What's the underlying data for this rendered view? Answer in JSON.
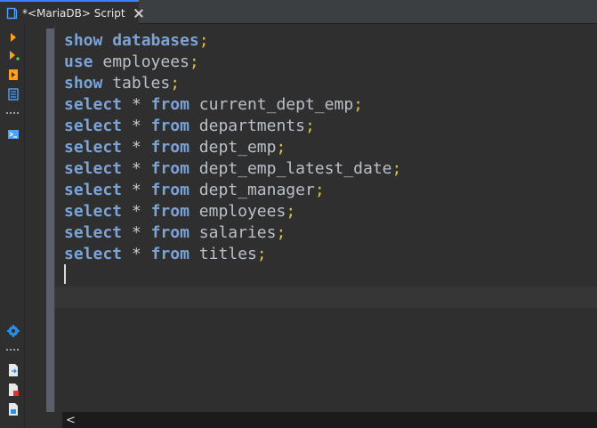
{
  "tab": {
    "title": "*<MariaDB> Script",
    "icon": "sql-script-icon"
  },
  "toolbar": {
    "items": [
      "execute-statement-icon",
      "execute-script-icon",
      "execute-new-tab-icon",
      "explain-plan-icon",
      "more-dots-icon",
      "show-output-icon",
      "settings-icon",
      "more-dots-icon",
      "export-icon",
      "import-icon",
      "save-file-icon"
    ]
  },
  "editor": {
    "lines": [
      [
        {
          "t": "kw",
          "v": "show"
        },
        {
          "t": "sp",
          "v": " "
        },
        {
          "t": "kw",
          "v": "databases"
        },
        {
          "t": "semi",
          "v": ";"
        }
      ],
      [
        {
          "t": "kw",
          "v": "use"
        },
        {
          "t": "sp",
          "v": " "
        },
        {
          "t": "id",
          "v": "employees"
        },
        {
          "t": "semi",
          "v": ";"
        }
      ],
      [
        {
          "t": "kw",
          "v": "show"
        },
        {
          "t": "sp",
          "v": " "
        },
        {
          "t": "id",
          "v": "tables"
        },
        {
          "t": "semi",
          "v": ";"
        }
      ],
      [
        {
          "t": "kw",
          "v": "select"
        },
        {
          "t": "sp",
          "v": " "
        },
        {
          "t": "op",
          "v": "*"
        },
        {
          "t": "sp",
          "v": " "
        },
        {
          "t": "kw",
          "v": "from"
        },
        {
          "t": "sp",
          "v": " "
        },
        {
          "t": "id",
          "v": "current_dept_emp"
        },
        {
          "t": "semi",
          "v": ";"
        }
      ],
      [
        {
          "t": "kw",
          "v": "select"
        },
        {
          "t": "sp",
          "v": " "
        },
        {
          "t": "op",
          "v": "*"
        },
        {
          "t": "sp",
          "v": " "
        },
        {
          "t": "kw",
          "v": "from"
        },
        {
          "t": "sp",
          "v": " "
        },
        {
          "t": "id",
          "v": "departments"
        },
        {
          "t": "semi",
          "v": ";"
        }
      ],
      [
        {
          "t": "kw",
          "v": "select"
        },
        {
          "t": "sp",
          "v": " "
        },
        {
          "t": "op",
          "v": "*"
        },
        {
          "t": "sp",
          "v": " "
        },
        {
          "t": "kw",
          "v": "from"
        },
        {
          "t": "sp",
          "v": " "
        },
        {
          "t": "id",
          "v": "dept_emp"
        },
        {
          "t": "semi",
          "v": ";"
        }
      ],
      [
        {
          "t": "kw",
          "v": "select"
        },
        {
          "t": "sp",
          "v": " "
        },
        {
          "t": "op",
          "v": "*"
        },
        {
          "t": "sp",
          "v": " "
        },
        {
          "t": "kw",
          "v": "from"
        },
        {
          "t": "sp",
          "v": " "
        },
        {
          "t": "id",
          "v": "dept_emp_latest_date"
        },
        {
          "t": "semi",
          "v": ";"
        }
      ],
      [
        {
          "t": "kw",
          "v": "select"
        },
        {
          "t": "sp",
          "v": " "
        },
        {
          "t": "op",
          "v": "*"
        },
        {
          "t": "sp",
          "v": " "
        },
        {
          "t": "kw",
          "v": "from"
        },
        {
          "t": "sp",
          "v": " "
        },
        {
          "t": "id",
          "v": "dept_manager"
        },
        {
          "t": "semi",
          "v": ";"
        }
      ],
      [
        {
          "t": "kw",
          "v": "select"
        },
        {
          "t": "sp",
          "v": " "
        },
        {
          "t": "op",
          "v": "*"
        },
        {
          "t": "sp",
          "v": " "
        },
        {
          "t": "kw",
          "v": "from"
        },
        {
          "t": "sp",
          "v": " "
        },
        {
          "t": "id",
          "v": "employees"
        },
        {
          "t": "semi",
          "v": ";"
        }
      ],
      [
        {
          "t": "kw",
          "v": "select"
        },
        {
          "t": "sp",
          "v": " "
        },
        {
          "t": "op",
          "v": "*"
        },
        {
          "t": "sp",
          "v": " "
        },
        {
          "t": "kw",
          "v": "from"
        },
        {
          "t": "sp",
          "v": " "
        },
        {
          "t": "id",
          "v": "salaries"
        },
        {
          "t": "semi",
          "v": ";"
        }
      ],
      [
        {
          "t": "kw",
          "v": "select"
        },
        {
          "t": "sp",
          "v": " "
        },
        {
          "t": "op",
          "v": "*"
        },
        {
          "t": "sp",
          "v": " "
        },
        {
          "t": "kw",
          "v": "from"
        },
        {
          "t": "sp",
          "v": " "
        },
        {
          "t": "id",
          "v": "titles"
        },
        {
          "t": "semi",
          "v": ";"
        }
      ]
    ]
  },
  "scrollbar": {
    "arrow": "<"
  },
  "colors": {
    "keyword": "#7ba3d6",
    "identifier": "#b9c0c9",
    "semicolon": "#d9c14a",
    "tab_accent": "#3c80ff"
  }
}
